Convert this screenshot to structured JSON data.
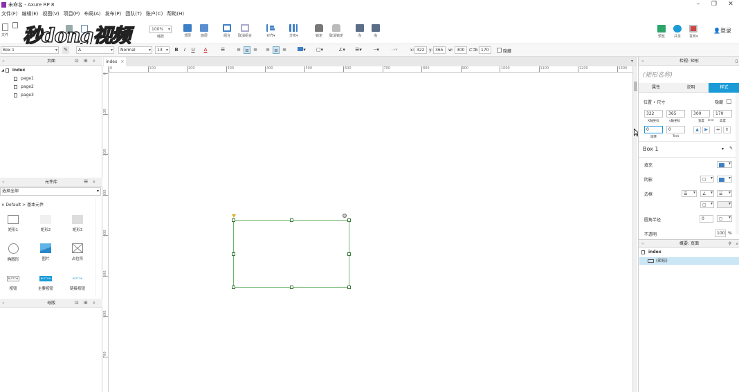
{
  "window": {
    "title": "未命名 - Axure RP 8",
    "minimize": "–",
    "restore": "❐",
    "close": "✕"
  },
  "menu": [
    "文件(F)",
    "编辑(E)",
    "视图(V)",
    "项目(P)",
    "布局(A)",
    "发布(P)",
    "团队(T)",
    "账户(C)",
    "帮助(H)"
  ],
  "toolbar": {
    "file_label": "文件",
    "zoom_value": "100%",
    "zoom_label": "缩放",
    "top_label": "顶层",
    "bottom_label": "底层",
    "group_label": "组合",
    "ungroup_label": "取消组合",
    "align_label": "对齐▾",
    "distribute_label": "分布▾",
    "lock_label": "锁定",
    "unlock_label": "取消锁定",
    "left_label": "左",
    "right_label": "右",
    "preview_label": "预览",
    "share_label": "共享",
    "publish_label": "发布▾",
    "login_label": "登录"
  },
  "watermark": "秒dong视频",
  "stylebar": {
    "widget_name": "Box 1",
    "font": "A",
    "font_style": "Normal",
    "font_size": "13",
    "x_label": "x:",
    "x": "322",
    "y_label": "y:",
    "y": "365",
    "w_label": "w:",
    "w": "300",
    "h_label": "h:",
    "h": "170",
    "hidden_label": "隐藏"
  },
  "pages_panel": {
    "title": "页面",
    "root": "index",
    "children": [
      "page1",
      "page2",
      "page3"
    ]
  },
  "library_panel": {
    "title": "元件库",
    "select": "选择全部",
    "group": "Default > 基本元件",
    "widgets": [
      {
        "label": "矩形1",
        "icon": "rectangle-icon"
      },
      {
        "label": "矩形2",
        "icon": "rectangle-gray-icon"
      },
      {
        "label": "矩形3",
        "icon": "rectangle-dark-icon"
      },
      {
        "label": "椭圆形",
        "icon": "ellipse-icon"
      },
      {
        "label": "图片",
        "icon": "image-icon"
      },
      {
        "label": "占位符",
        "icon": "placeholder-icon"
      },
      {
        "label": "按钮",
        "icon": "button-icon",
        "text": "BUTTON"
      },
      {
        "label": "主要按钮",
        "icon": "primary-button-icon",
        "text": "BUTTON"
      },
      {
        "label": "链接按钮",
        "icon": "link-button-icon",
        "text": "BUTTON"
      }
    ]
  },
  "masters_panel": {
    "title": "母版"
  },
  "canvas": {
    "tab": "index",
    "h_ticks": [
      "0",
      "100",
      "200",
      "300",
      "400",
      "500",
      "600",
      "700",
      "800",
      "900",
      "1000",
      "1100",
      "1200",
      "1300"
    ],
    "v_ticks": [
      "0",
      "100",
      "200",
      "300",
      "400",
      "500",
      "600",
      "700"
    ]
  },
  "inspector": {
    "header": "检视: 矩形",
    "name_placeholder": "(矩形名称)",
    "tabs": [
      "属性",
      "说明",
      "样式"
    ],
    "position_label": "位置 • 尺寸",
    "hidden_label": "隐藏",
    "x": "322",
    "y": "365",
    "w": "300",
    "h": "170",
    "x_caption": "X轴坐标",
    "y_caption": "y轴坐标",
    "w_caption": "宽度",
    "h_caption": "高度",
    "rotation": "0",
    "text_rotation": "0",
    "rotation_caption": "旋转",
    "text_caption": "Text",
    "style_name": "Box 1",
    "fill_label": "填充",
    "shadow_label": "阴影",
    "border_label": "边框",
    "radius_label": "圆角半径",
    "radius": "0",
    "opacity_label": "不透明",
    "opacity": "100",
    "opacity_unit": "%",
    "accent": "#1a9bd7"
  },
  "outline_panel": {
    "title": "概要: 页面",
    "root": "index",
    "item": "(矩形)"
  }
}
